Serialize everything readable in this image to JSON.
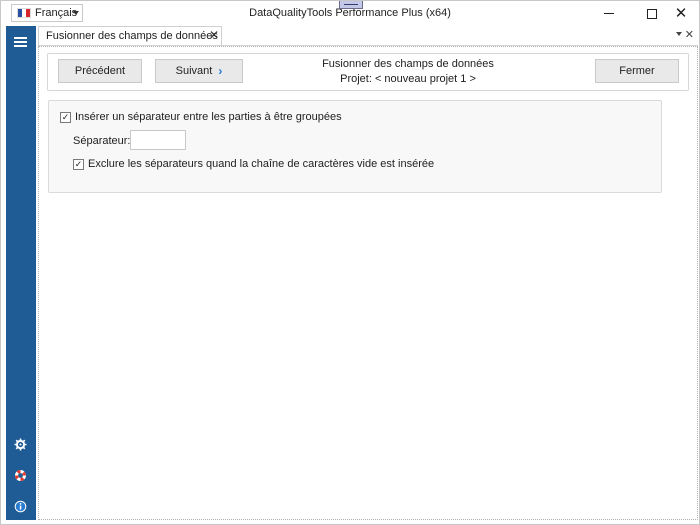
{
  "window": {
    "title": "DataQualityTools Performance Plus (x64)",
    "language": "Français",
    "controls": {
      "minimize": "—",
      "maximize": "□",
      "close": "✕"
    }
  },
  "sidebar": {
    "menu_icon": "hamburger-icon",
    "bottom_icons": [
      "gear-icon",
      "lifebuoy-icon",
      "info-icon"
    ]
  },
  "tab": {
    "label": "Fusionner des champs de données",
    "close": "✕"
  },
  "tabstrip": {
    "close": "✕"
  },
  "toolbar": {
    "previous_label": "Précédent",
    "next_label": "Suivant",
    "next_arrow": "›",
    "title": "Fusionner des champs de données",
    "project": "Projet: < nouveau projet 1 >",
    "close_label": "Fermer"
  },
  "options": {
    "insert_separator": {
      "label": "Insérer un séparateur entre les parties à être groupées",
      "checked": true
    },
    "separator": {
      "label": "Séparateur:",
      "value": ""
    },
    "exclude_separators": {
      "label": "Exclure les séparateurs quand la chaîne de caractères vide est insérée",
      "checked": true
    }
  },
  "colors": {
    "sidebar": "#1f5b94",
    "accent": "#1e7bd8"
  }
}
